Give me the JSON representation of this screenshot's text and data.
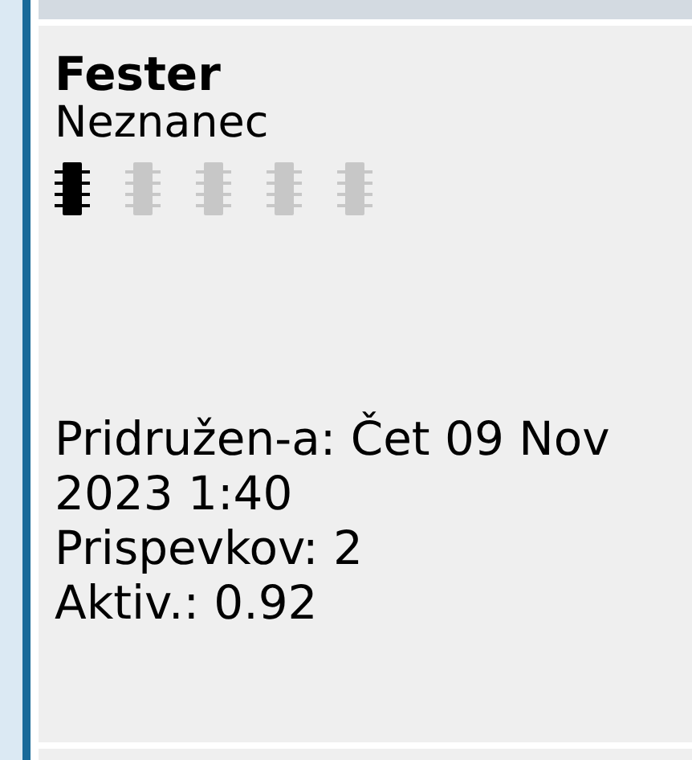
{
  "profile": {
    "username": "Fester",
    "rank": "Neznanec",
    "stars": 1,
    "details": [
      "Pridružen-a: Čet 09 Nov 2023 1:40",
      "Prispevkov: 2",
      "Aktiv.: 0.92"
    ]
  }
}
